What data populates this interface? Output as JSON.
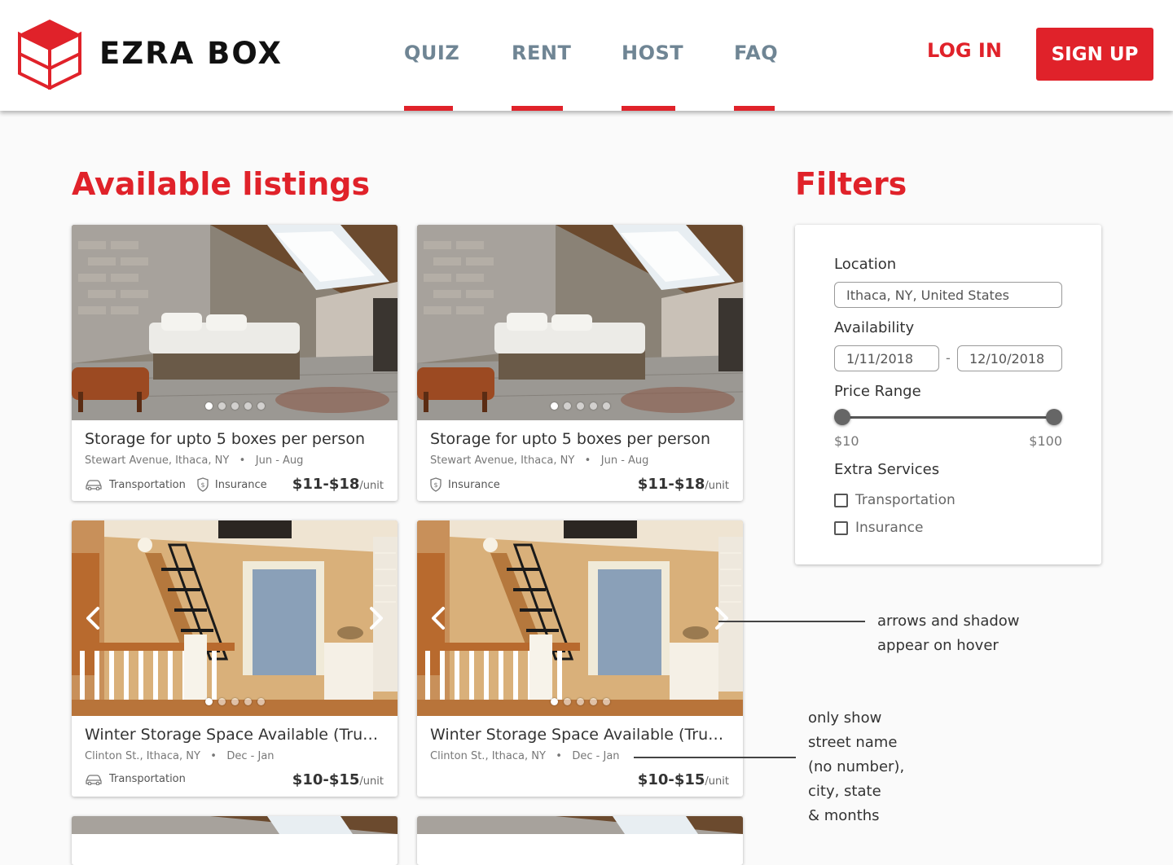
{
  "brand": {
    "name": "EZRA BOX",
    "color": "#e0222a"
  },
  "nav": [
    {
      "label": "QUIZ"
    },
    {
      "label": "RENT"
    },
    {
      "label": "HOST"
    },
    {
      "label": "FAQ"
    }
  ],
  "auth": {
    "login": "LOG IN",
    "signup": "SIGN UP"
  },
  "listings_title": "Available listings",
  "filters_title": "Filters",
  "listings": [
    {
      "title": "Storage for upto 5 boxes per person",
      "address": "Stewart Avenue, Ithaca, NY",
      "months": "Jun - Aug",
      "services": [
        "Transportation",
        "Insurance"
      ],
      "price": "$11-$18",
      "unit": "/unit",
      "photo": "attic-bedroom",
      "dots": 5,
      "active_dot": 0
    },
    {
      "title": "Storage for upto 5 boxes per person",
      "address": "Stewart Avenue, Ithaca, NY",
      "months": "Jun - Aug",
      "services": [
        "Insurance"
      ],
      "price": "$11-$18",
      "unit": "/unit",
      "photo": "attic-bedroom",
      "dots": 5,
      "active_dot": 0
    },
    {
      "title": "Winter Storage Space Available (Truck…",
      "address": "Clinton St., Ithaca, NY",
      "months": "Dec - Jan",
      "services": [
        "Transportation"
      ],
      "price": "$10-$15",
      "unit": "/unit",
      "photo": "attic-ladder-hallway",
      "dots": 5,
      "active_dot": 0
    },
    {
      "title": "Winter Storage Space Available (Truck…",
      "address": "Clinton St., Ithaca, NY",
      "months": "Dec - Jan",
      "services": [],
      "price": "$10-$15",
      "unit": "/unit",
      "photo": "attic-ladder-hallway",
      "dots": 5,
      "active_dot": 0
    }
  ],
  "filters": {
    "location_label": "Location",
    "location_value": "Ithaca, NY, United States",
    "availability_label": "Availability",
    "date_from": "1/11/2018",
    "date_separator": "-",
    "date_to": "12/10/2018",
    "price_label": "Price Range",
    "price_min": "$10",
    "price_max": "$100",
    "extra_label": "Extra Services",
    "extra_options": [
      "Transportation",
      "Insurance"
    ]
  },
  "annotations": {
    "hover_note": [
      "arrows and shadow",
      "appear on hover"
    ],
    "address_note": [
      "only show",
      "street name",
      "(no number),",
      "city, state",
      "& months"
    ]
  }
}
